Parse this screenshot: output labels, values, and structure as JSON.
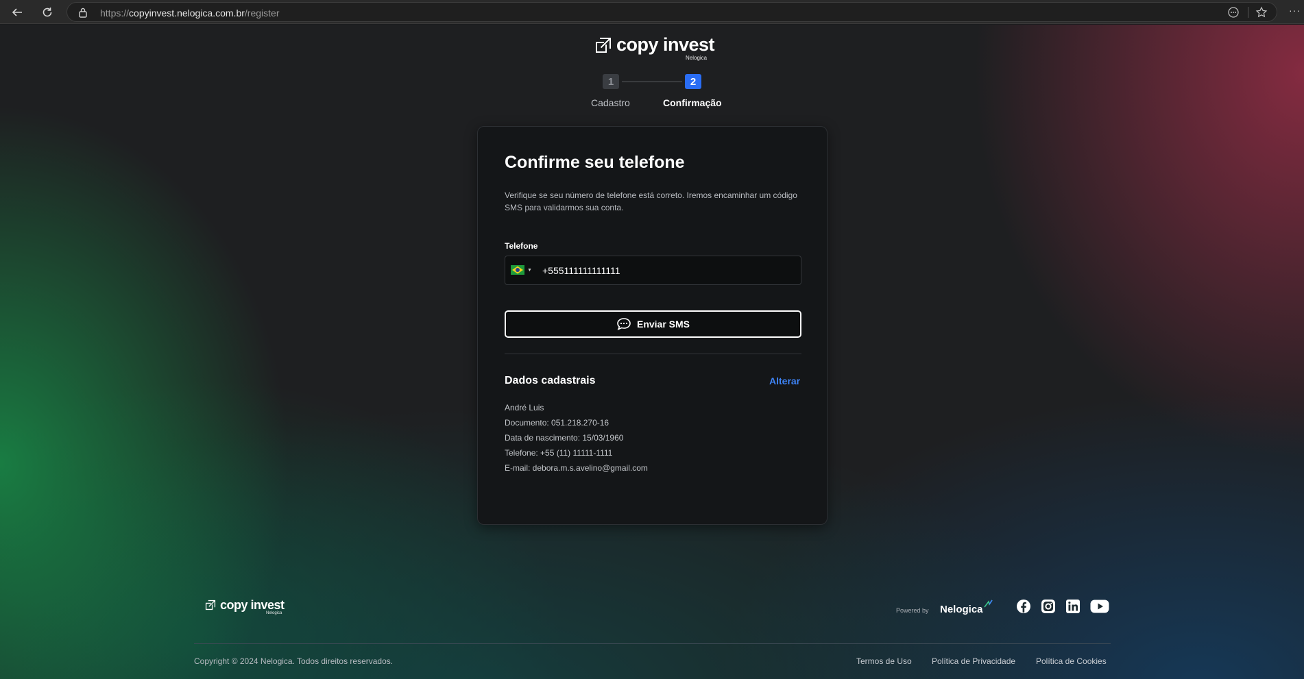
{
  "browser": {
    "url_prefix": "https://",
    "url_domain": "copyinvest.nelogica.com.br",
    "url_path": "/register",
    "more": "···"
  },
  "header": {
    "logo_text": "copy invest",
    "logo_sub": "Nelogica"
  },
  "stepper": {
    "steps": [
      {
        "number": "1",
        "label": "Cadastro"
      },
      {
        "number": "2",
        "label": "Confirmação"
      }
    ]
  },
  "card": {
    "title": "Confirme seu telefone",
    "description": "Verifique se seu número de telefone está correto. Iremos encaminhar um código SMS para validarmos sua conta.",
    "phone_label": "Telefone",
    "phone_value": "+555111111111111",
    "send_button": "Enviar SMS",
    "section_title": "Dados cadastrais",
    "edit_link": "Alterar",
    "info": [
      "André Luis",
      "Documento: 051.218.270-16",
      "Data de nascimento: 15/03/1960",
      "Telefone: +55 (11) 11111-1111",
      "E-mail: debora.m.s.avelino@gmail.com"
    ]
  },
  "footer": {
    "logo_text": "copy invest",
    "logo_sub": "Nelogica",
    "powered_by": "Powered by",
    "brand": "Nelogica",
    "copyright": "Copyright © 2024 Nelogica. Todos direitos reservados.",
    "links": [
      "Termos de Uso",
      "Política de Privacidade",
      "Política de Cookies"
    ],
    "social_icons": [
      "facebook-icon",
      "instagram-icon",
      "linkedin-icon",
      "youtube-icon"
    ]
  },
  "colors": {
    "accent": "#2a6df4",
    "link": "#3e83f5",
    "card_bg": "#141618"
  }
}
